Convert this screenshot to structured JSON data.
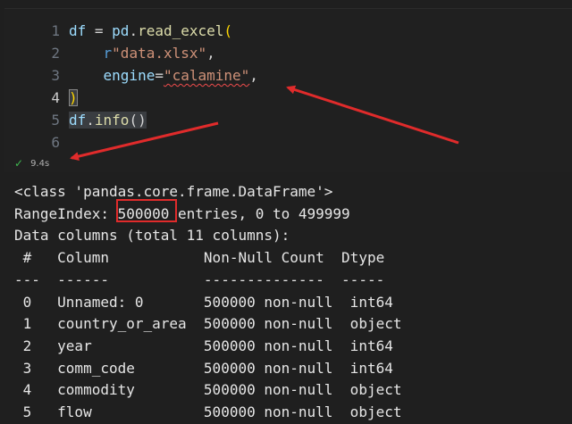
{
  "editor": {
    "line_numbers": [
      "1",
      "2",
      "3",
      "4",
      "5",
      "6"
    ],
    "lines": {
      "l1": {
        "a": "df",
        "b": " = ",
        "c": "pd",
        "d": ".",
        "e": "read_excel",
        "f": "("
      },
      "l2": {
        "a": "r",
        "b": "\"data.xlsx\"",
        "c": ","
      },
      "l3": {
        "a": "engine",
        "b": "=",
        "c": "\"calamine\"",
        "d": ","
      },
      "l4": {
        "a": ")"
      },
      "l5": {
        "a": "df",
        "b": ".",
        "c": "info",
        "d": "()"
      },
      "l6": {
        "a": ""
      }
    },
    "exec_time": "9.4s",
    "status_icon": "check-icon"
  },
  "output": {
    "lines": [
      "<class 'pandas.core.frame.DataFrame'>",
      "RangeIndex: 500000 entries, 0 to 499999",
      "Data columns (total 11 columns):",
      " #   Column           Non-Null Count  Dtype ",
      "---  ------           --------------  ----- ",
      " 0   Unnamed: 0       500000 non-null  int64 ",
      " 1   country_or_area  500000 non-null  object",
      " 2   year             500000 non-null  int64 ",
      " 3   comm_code        500000 non-null  int64 ",
      " 4   commodity        500000 non-null  object",
      " 5   flow             500000 non-null  object"
    ]
  },
  "colors": {
    "annotation_red": "#e02b2b",
    "check_green": "#3fb950"
  }
}
